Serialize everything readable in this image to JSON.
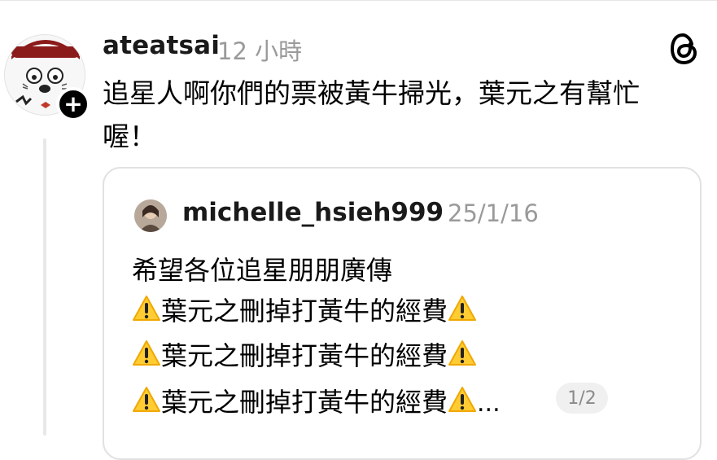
{
  "post": {
    "username": "ateatsai",
    "time": "12 小時",
    "text_line1": "追星人啊你們的票被黃牛掃光，葉元之有幫忙",
    "text_line2": "喔！"
  },
  "quote": {
    "username": "michelle_hsieh999",
    "date": "25/1/16",
    "line1": "希望各位追星朋朋廣傳",
    "warning_text": "葉元之刪掉打黃牛的經費",
    "ellipsis": "...",
    "page_indicator": "1/2"
  },
  "icons": {
    "avatar": "cartoon-face-avatar",
    "follow": "plus-icon",
    "logo": "threads-logo-icon",
    "warning": "warning-emoji-icon"
  },
  "colors": {
    "text": "#000000",
    "muted": "#9a9a9a",
    "border": "#e1e1e1",
    "warning": "#ffcc33"
  }
}
